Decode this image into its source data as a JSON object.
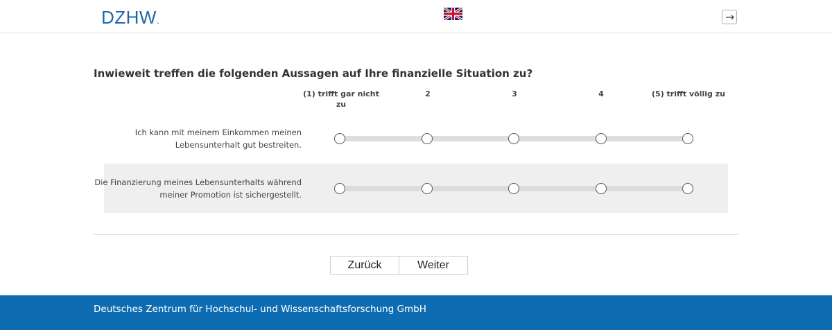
{
  "header": {
    "logo_text": "DZHW",
    "logo_dot": ".",
    "language_flag": "uk-flag-icon",
    "logout_icon": "logout-icon"
  },
  "question": {
    "title": "Inwieweit treffen die folgenden Aussagen auf Ihre finanzielle Situation zu?",
    "scale": [
      "(1) trifft gar nicht zu",
      "2",
      "3",
      "4",
      "(5) trifft völlig zu"
    ],
    "items": [
      {
        "label": "Ich kann mit meinem Einkommen meinen Lebensunterhalt gut bestreiten.",
        "selected": null
      },
      {
        "label": "Die Finanzierung meines Lebensunterhalts während meiner Promotion ist sichergestellt.",
        "selected": null
      }
    ]
  },
  "nav": {
    "back_label": "Zurück",
    "next_label": "Weiter"
  },
  "footer": {
    "text": "Deutsches Zentrum für Hochschul- und Wissenschaftsforschung GmbH"
  },
  "colors": {
    "brand": "#1f67ab",
    "footer_bg": "#0e6db2"
  }
}
